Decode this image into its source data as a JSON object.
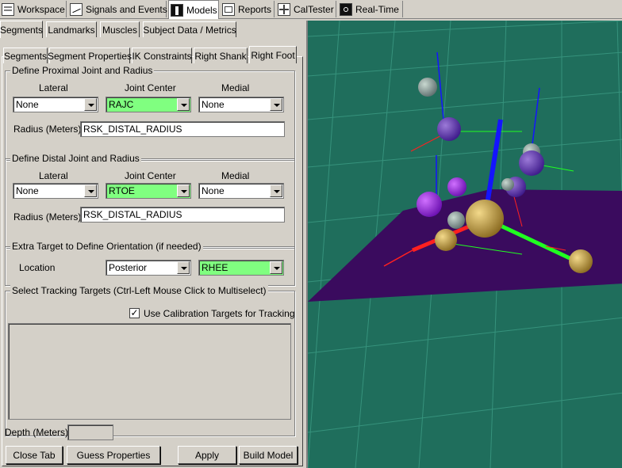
{
  "top_tabs": [
    {
      "label": "Workspace",
      "icon": "workspace-icon"
    },
    {
      "label": "Signals and Events",
      "icon": "signals-icon"
    },
    {
      "label": "Models",
      "icon": "models-icon"
    },
    {
      "label": "Reports",
      "icon": "reports-icon"
    },
    {
      "label": "CalTester",
      "icon": "caltester-icon"
    },
    {
      "label": "Real-Time",
      "icon": "realtime-icon"
    }
  ],
  "main_tabs": [
    "Segments",
    "Landmarks",
    "Muscles",
    "Subject Data / Metrics"
  ],
  "sub_tabs": [
    "Segments",
    "Segment Properties",
    "IK Constraints",
    "Right Shank",
    "Right Foot"
  ],
  "proximal": {
    "title": "Define Proximal Joint and Radius",
    "col_lateral": "Lateral",
    "col_center": "Joint Center",
    "col_medial": "Medial",
    "lateral": "None",
    "center": "RAJC",
    "medial": "None",
    "radius_label": "Radius (Meters)",
    "radius_value": "RSK_DISTAL_RADIUS"
  },
  "distal": {
    "title": "Define Distal Joint and Radius",
    "col_lateral": "Lateral",
    "col_center": "Joint Center",
    "col_medial": "Medial",
    "lateral": "None",
    "center": "RTOE",
    "medial": "None",
    "radius_label": "Radius (Meters)",
    "radius_value": "RSK_DISTAL_RADIUS"
  },
  "orientation": {
    "title": "Extra Target to Define Orientation (if needed)",
    "location_label": "Location",
    "location_value": "Posterior",
    "target_value": "RHEE"
  },
  "tracking": {
    "title": "Select Tracking Targets (Ctrl-Left Mouse Click to Multiselect)",
    "checkbox_label": "Use Calibration Targets for Tracking",
    "checked": true
  },
  "depth": {
    "label": "Depth (Meters):",
    "value": ""
  },
  "buttons": {
    "close_tab": "Close Tab",
    "guess": "Guess Properties",
    "apply": "Apply",
    "build": "Build Model"
  },
  "colors": {
    "selected_field": "#80ff80",
    "viewport_bg": "#1f6e5c",
    "floor": "#3a0b5e"
  }
}
